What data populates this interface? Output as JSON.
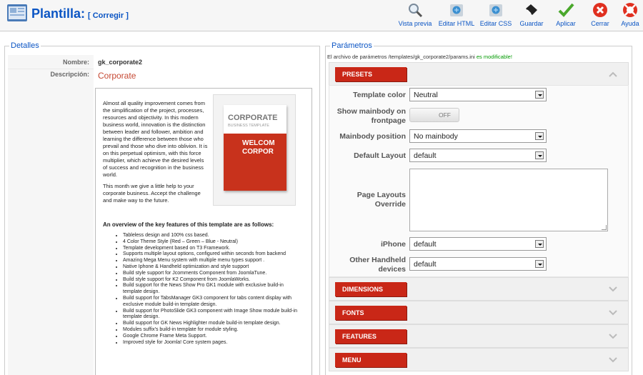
{
  "header": {
    "title": "Plantilla:",
    "subtitle": "[ Corregir ]",
    "toolbar": [
      {
        "label": "Vista previa",
        "icon": "preview-magnifier-icon"
      },
      {
        "label": "Editar HTML",
        "icon": "edit-html-icon"
      },
      {
        "label": "Editar CSS",
        "icon": "edit-css-icon"
      },
      {
        "label": "Guardar",
        "icon": "save-icon"
      },
      {
        "label": "Aplicar",
        "icon": "apply-check-icon"
      },
      {
        "label": "Cerrar",
        "icon": "close-icon"
      },
      {
        "label": "Ayuda",
        "icon": "help-lifebuoy-icon"
      }
    ]
  },
  "details": {
    "legend": "Detalles",
    "name_label": "Nombre:",
    "name_value": "gk_corporate2",
    "desc_label": "Descripción:",
    "desc_title": "Corporate",
    "paragraph1": "Almost all quality improvement comes from the simplification of the project, processes, resources and objectivity. In this modern business world, innovation is the distinction between leader and follower, ambition and learning the difference between those who prevail and those who dive into oblivion. It is on this perpetual optimism, with this force multiplier, which achieve the desired levels of success and recognition in the business world.",
    "paragraph2": "This month we give a little help to your corporate business. Accept the challenge and make way to the future.",
    "thumb_title": "CORPORATE",
    "thumb_subtitle": "BUSINESS TEMPLATE",
    "thumb_welcome_1": "WELCOM",
    "thumb_welcome_2": "CORPOR",
    "overview_title": "An overview of the key features of this template are as follows:",
    "features": [
      "Tableless design and 100% css based.",
      "4 Color Theme Style (Red – Green – Blue - Neutral)",
      "Template development based on T3 Framework.",
      "Supports multiple layout options, configured within seconds from backend",
      "Amazing Mega Menu system with multiple menu types support .",
      "Native Iphone & Handheld optimization and style support",
      "Build style support for Jcomments Component from JoomlaTune.",
      "Build style support for K2 Component from JoomlaWorks.",
      "Build support for the News Show Pro GK1 module with exclusive build-in template design.",
      "Build support for TabsManager GK3 component for tabs content display with exclusive module build-in template design.",
      "Build support for PhotoSlide GK3 component with Image Show module build-in template design.",
      "Build support for GK News Highlighter module build-in template design.",
      "Modules suffix's build-in template for module styling.",
      "Google Chrome Frame Meta Support.",
      "Improved style for Joomla! Core system pages."
    ]
  },
  "params": {
    "legend": "Parámetros",
    "file_msg": "El archivo de parámetros /templates/gk_corporate2/params.ini",
    "file_status": "es modificable!",
    "panels": [
      "PRESETS",
      "DIMENSIONS",
      "FONTS",
      "FEATURES",
      "MENU"
    ],
    "template_color_label": "Template color",
    "template_color_value": "Neutral",
    "show_mainbody_label_1": "Show mainbody on",
    "show_mainbody_label_2": "frontpage",
    "toggle_value": "OFF",
    "mainbody_position_label": "Mainbody position",
    "mainbody_position_value": "No mainbody",
    "default_layout_label": "Default Layout",
    "default_layout_value": "default",
    "page_layouts_label_1": "Page Layouts",
    "page_layouts_label_2": "Override",
    "iphone_label": "iPhone",
    "iphone_value": "default",
    "other_handheld_label_1": "Other Handheld",
    "other_handheld_label_2": "devices",
    "other_handheld_value": "default"
  }
}
